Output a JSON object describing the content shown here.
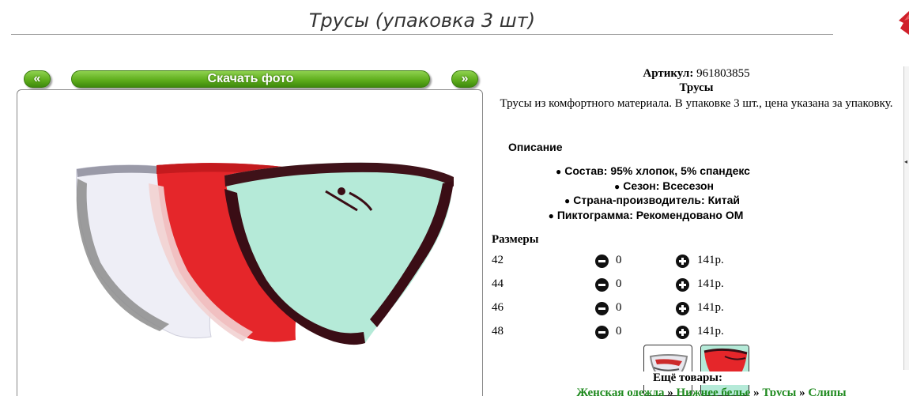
{
  "page": {
    "title": "Трусы (упаковка 3 шт)"
  },
  "gallery": {
    "prev_label": "«",
    "download_label": "Скачать фото",
    "next_label": "»"
  },
  "product": {
    "sku_label": "Артикул:",
    "sku_value": "961803855",
    "name": "Трусы",
    "description": "Трусы из комфортного материала. В упаковке 3 шт., цена указана за упаковку."
  },
  "details": {
    "heading": "Описание",
    "features": [
      "Состав: 95% хлопок, 5% спандекс",
      "Сезон: Всесезон",
      "Страна-производитель: Китай",
      "Пиктограмма: Рекомендовано ОМ"
    ]
  },
  "sizes": {
    "heading": "Размеры",
    "rows": [
      {
        "size": "42",
        "qty": "0",
        "price": "141р."
      },
      {
        "size": "44",
        "qty": "0",
        "price": "141р."
      },
      {
        "size": "46",
        "qty": "0",
        "price": "141р."
      },
      {
        "size": "48",
        "qty": "0",
        "price": "141р."
      }
    ]
  },
  "more": {
    "heading": "Ещё товары:",
    "breadcrumb": [
      "Женская одежда",
      "Нижнее белье",
      "Трусы",
      "Слипы"
    ],
    "separator": "»"
  },
  "colors": {
    "accent_green": "#5fae1d",
    "link_green": "#1f8a1f",
    "brand_red": "#d0202a"
  }
}
